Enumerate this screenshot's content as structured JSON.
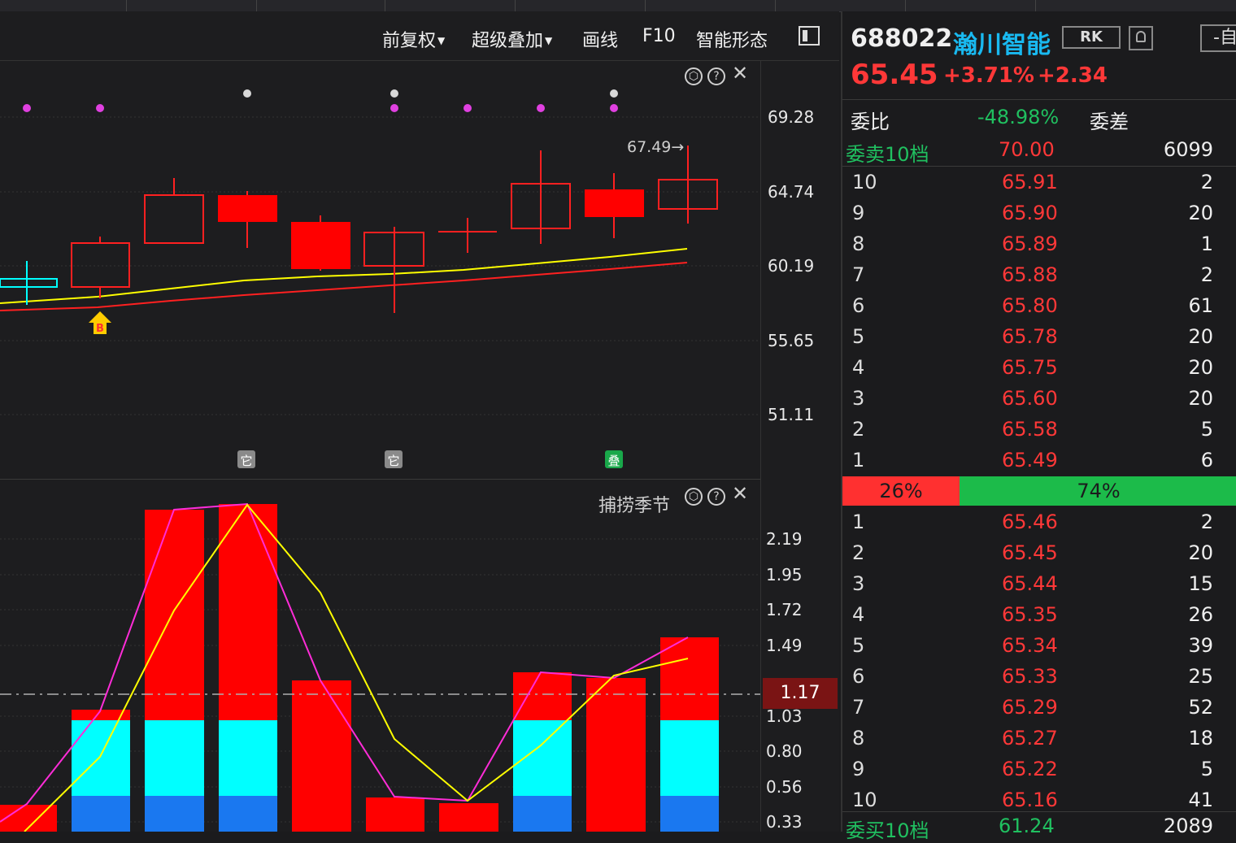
{
  "toolbar": {
    "adjust": "前复权",
    "overlay": "超级叠加",
    "draw": "画线",
    "f10": "F10",
    "pattern": "智能形态"
  },
  "kline": {
    "y_ticks": [
      "69.28",
      "64.74",
      "60.19",
      "55.65",
      "51.11"
    ],
    "annotation": "67.49→",
    "buy_marker": "B",
    "event_markers": [
      "它",
      "它",
      "叠"
    ]
  },
  "indicator": {
    "title": "捕捞季节",
    "y_ticks": [
      "2.19",
      "1.95",
      "1.72",
      "1.49",
      "1.03",
      "0.80",
      "0.56",
      "0.33"
    ],
    "current_value": "1.17"
  },
  "quote": {
    "code": "688022",
    "name": "瀚川智能",
    "rk_label": "RK",
    "self_label": "-自",
    "price": "65.45",
    "change_pct": "+3.71%",
    "change": "+2.34",
    "weibi_label": "委比",
    "weibi_value": "-48.98%",
    "weicha_label": "委差",
    "sell_header": {
      "label": "委卖10档",
      "price": "70.00",
      "volume": "6099"
    },
    "asks": [
      {
        "level": "10",
        "price": "65.91",
        "volume": "2"
      },
      {
        "level": "9",
        "price": "65.90",
        "volume": "20"
      },
      {
        "level": "8",
        "price": "65.89",
        "volume": "1"
      },
      {
        "level": "7",
        "price": "65.88",
        "volume": "2"
      },
      {
        "level": "6",
        "price": "65.80",
        "volume": "61"
      },
      {
        "level": "5",
        "price": "65.78",
        "volume": "20"
      },
      {
        "level": "4",
        "price": "65.75",
        "volume": "20"
      },
      {
        "level": "3",
        "price": "65.60",
        "volume": "20"
      },
      {
        "level": "2",
        "price": "65.58",
        "volume": "5"
      },
      {
        "level": "1",
        "price": "65.49",
        "volume": "6"
      }
    ],
    "buy_ratio": "26%",
    "sell_ratio": "74%",
    "bids": [
      {
        "level": "1",
        "price": "65.46",
        "volume": "2"
      },
      {
        "level": "2",
        "price": "65.45",
        "volume": "20"
      },
      {
        "level": "3",
        "price": "65.44",
        "volume": "15"
      },
      {
        "level": "4",
        "price": "65.35",
        "volume": "26"
      },
      {
        "level": "5",
        "price": "65.34",
        "volume": "39"
      },
      {
        "level": "6",
        "price": "65.33",
        "volume": "25"
      },
      {
        "level": "7",
        "price": "65.29",
        "volume": "52"
      },
      {
        "level": "8",
        "price": "65.27",
        "volume": "18"
      },
      {
        "level": "9",
        "price": "65.22",
        "volume": "5"
      },
      {
        "level": "10",
        "price": "65.16",
        "volume": "41"
      }
    ],
    "buy_footer": {
      "label": "委买10档",
      "price": "61.24",
      "volume": "2089"
    }
  },
  "colors": {
    "up": "#ff2020",
    "down": "#00ffff",
    "ma_short": "#ffff00",
    "ma_long": "#ff2020"
  }
}
